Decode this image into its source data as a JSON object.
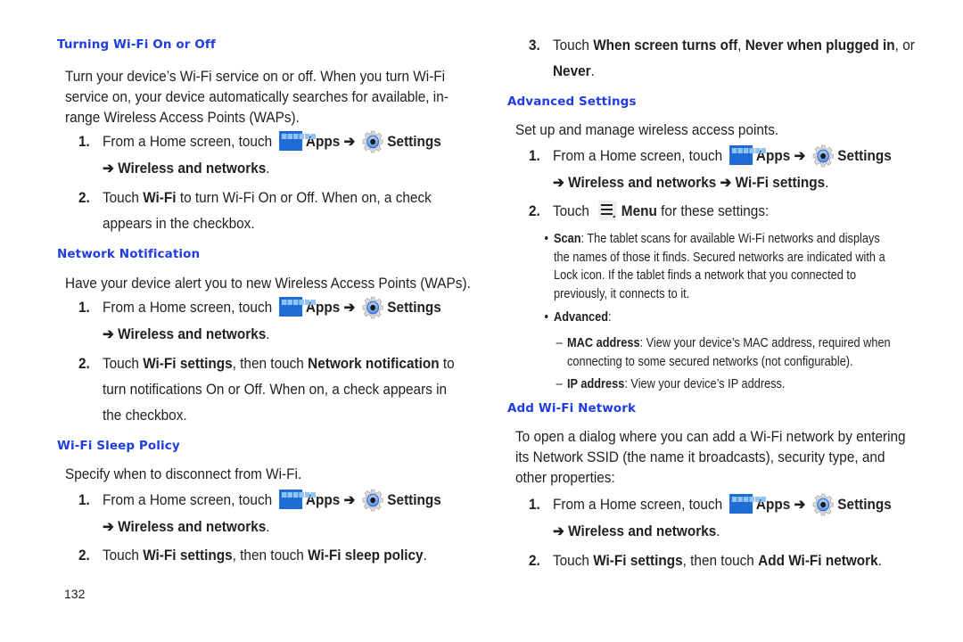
{
  "page_number": "132",
  "common": {
    "from_home": "From a Home screen, touch",
    "apps": "Apps",
    "arrow": "➔",
    "settings": "Settings",
    "wireless": "Wireless and networks",
    "touch": "Touch",
    "period": "."
  },
  "icons": {
    "apps": "apps-grid-icon",
    "settings": "settings-gear-icon",
    "menu": "menu-icon"
  },
  "left": {
    "s1": {
      "heading": "Turning Wi-Fi On or Off",
      "intro": [
        "Turn your device’s Wi-Fi service on or off. When you turn Wi-Fi",
        "service on, your device automatically searches for available, in-",
        "range Wireless Access Points (WAPs)."
      ],
      "step2_num": "2.",
      "step2_bold": "Wi-Fi",
      "step2_text": " to turn Wi-Fi On or Off. When on, a check",
      "step2_line2": "appears in the checkbox."
    },
    "s2": {
      "heading": "Network Notification",
      "intro": "Have your device alert you to new Wireless Access Points (WAPs).",
      "step2_num": "2.",
      "step2_b1": "Wi-Fi settings",
      "step2_t1": ", then touch ",
      "step2_b2": "Network notification",
      "step2_t2": " to",
      "step2_line2": "turn notifications On or Off. When on, a check appears in",
      "step2_line3": "the checkbox."
    },
    "s3": {
      "heading": "Wi-Fi Sleep Policy",
      "intro": "Specify when to disconnect from Wi-Fi.",
      "step2_num": "2.",
      "step2_b1": "Wi-Fi settings",
      "step2_t1": ", then touch ",
      "step2_b2": "Wi-Fi sleep policy",
      "step2_t2": "."
    }
  },
  "right": {
    "s3_step3": {
      "num": "3.",
      "b1": "When screen turns off",
      "t1": ", ",
      "b2": "Never when plugged in",
      "t2": ", or",
      "b3": "Never",
      "t3": "."
    },
    "s4": {
      "heading": "Advanced Settings",
      "intro": "Set up and manage wireless access points.",
      "step1_extra": "Wi-Fi settings",
      "step2_num": "2.",
      "step2_bold": "Menu",
      "step2_text": " for these settings:",
      "bullets": [
        {
          "bold": "Scan",
          "text": ": The tablet scans for available Wi-Fi networks and displays",
          "lines": [
            "the names of those it finds. Secured networks are indicated with a",
            "Lock icon. If the tablet finds a network that you connected to",
            "previously, it connects to it."
          ]
        },
        {
          "bold": "Advanced",
          "text": ":"
        }
      ],
      "dashes": [
        {
          "bold": "MAC address",
          "text": ": View your device’s MAC address, required when",
          "line2": "connecting to some secured networks (not configurable)."
        },
        {
          "bold": "IP address",
          "text": ": View your device’s IP address."
        }
      ]
    },
    "s5": {
      "heading": "Add Wi-Fi Network",
      "intro": [
        "To open a dialog where you can add a Wi-Fi network by entering",
        "its Network SSID (the name it broadcasts), security type, and",
        "other properties:"
      ],
      "step2_num": "2.",
      "step2_b1": "Wi-Fi settings",
      "step2_t1": ", then touch ",
      "step2_b2": "Add Wi-Fi network",
      "step2_t2": "."
    }
  },
  "step1_num": "1."
}
